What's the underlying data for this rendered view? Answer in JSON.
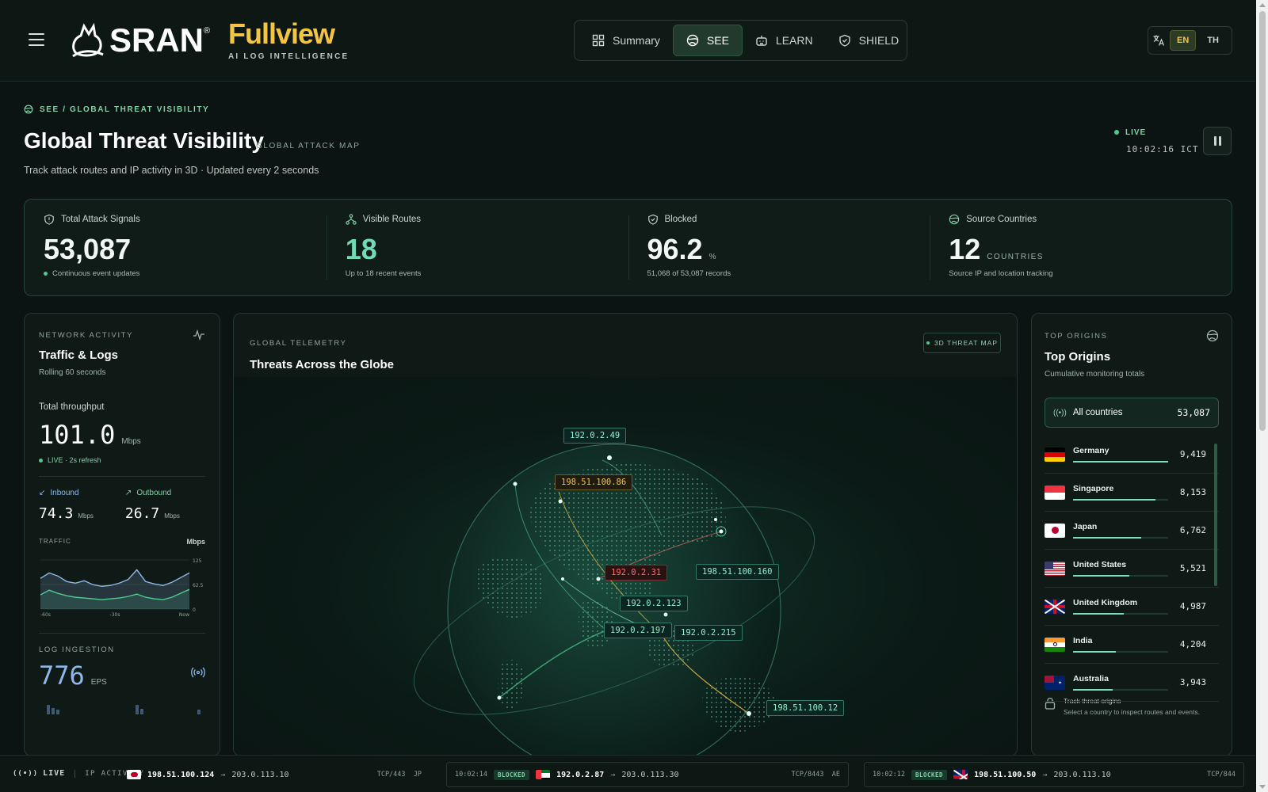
{
  "header": {
    "logo_text": "SRAN",
    "logo_reg": "®",
    "brand_title": "Fullview",
    "brand_sub": "AI LOG INTELLIGENCE",
    "nav": [
      {
        "label": "Summary",
        "icon": "grid-icon"
      },
      {
        "label": "SEE",
        "icon": "globe-icon",
        "active": true
      },
      {
        "label": "LEARN",
        "icon": "robot-icon"
      },
      {
        "label": "SHIELD",
        "icon": "shield-icon"
      }
    ],
    "lang": {
      "en": "EN",
      "th": "TH",
      "active": "EN"
    }
  },
  "page": {
    "breadcrumb": "SEE / GLOBAL THREAT VISIBILITY",
    "title": "Global Threat Visibility",
    "tag": "GLOBAL ATTACK MAP",
    "desc": "Track attack routes and IP activity in 3D · Updated every 2 seconds",
    "live_label": "LIVE",
    "clock": "10:02:16 ICT"
  },
  "stats": [
    {
      "label": "Total Attack Signals",
      "value": "53,087",
      "unit": "",
      "note": "Continuous event updates",
      "icon": "shield-icon"
    },
    {
      "label": "Visible Routes",
      "value": "18",
      "unit": "",
      "note": "Up to 18 recent events",
      "icon": "route-icon"
    },
    {
      "label": "Blocked",
      "value": "96.2",
      "unit": "%",
      "note": "51,068 of 53,087 records",
      "icon": "shield-check-icon"
    },
    {
      "label": "Source Countries",
      "value": "12",
      "unit": "COUNTRIES",
      "note": "Source IP and location tracking",
      "icon": "globe-icon"
    }
  ],
  "network": {
    "eyebrow": "NETWORK ACTIVITY",
    "title": "Traffic & Logs",
    "sub": "Rolling 60 seconds",
    "throughput_label": "Total throughput",
    "throughput_value": "101.0",
    "throughput_unit": "Mbps",
    "live_note": "LIVE · 2s refresh",
    "inbound_label": "Inbound",
    "inbound_value": "74.3",
    "outbound_label": "Outbound",
    "outbound_value": "26.7",
    "io_unit": "Mbps",
    "traffic_label": "TRAFFIC",
    "traffic_unit": "Mbps",
    "y_ticks": [
      "125",
      "62.5",
      "0"
    ],
    "x_ticks": [
      "-60s",
      "-30s",
      "Now"
    ],
    "inbound_series": [
      78,
      92,
      84,
      70,
      66,
      72,
      62,
      58,
      60,
      66,
      75,
      100,
      70,
      64,
      60,
      68,
      80,
      92
    ],
    "outbound_series": [
      36,
      48,
      40,
      34,
      30,
      28,
      26,
      24,
      26,
      28,
      32,
      38,
      30,
      26,
      24,
      30,
      40,
      50
    ],
    "log_label": "LOG INGESTION",
    "log_value": "776",
    "log_unit": "EPS",
    "colors": {
      "inbound": "#8fb8e8",
      "outbound": "#4ecb8f"
    }
  },
  "globe": {
    "eyebrow": "GLOBAL TELEMETRY",
    "title": "Threats Across the Globe",
    "button": "3D THREAT MAP",
    "ips": [
      {
        "ip": "192.0.2.49",
        "status": "normal"
      },
      {
        "ip": "198.51.100.86",
        "status": "warn"
      },
      {
        "ip": "192.0.2.31",
        "status": "bad"
      },
      {
        "ip": "198.51.100.160",
        "status": "normal"
      },
      {
        "ip": "192.0.2.123",
        "status": "normal"
      },
      {
        "ip": "192.0.2.197",
        "status": "normal"
      },
      {
        "ip": "192.0.2.215",
        "status": "normal"
      },
      {
        "ip": "198.51.100.12",
        "status": "normal"
      }
    ]
  },
  "origins": {
    "eyebrow": "TOP ORIGINS",
    "title": "Top Origins",
    "sub": "Cumulative monitoring totals",
    "all_label": "All countries",
    "all_value": "53,087",
    "items": [
      {
        "name": "Germany",
        "value": "9,419",
        "share": 1.0,
        "flag": "de"
      },
      {
        "name": "Singapore",
        "value": "8,153",
        "share": 0.87,
        "flag": "sg"
      },
      {
        "name": "Japan",
        "value": "6,762",
        "share": 0.72,
        "flag": "jp"
      },
      {
        "name": "United States",
        "value": "5,521",
        "share": 0.59,
        "flag": "us"
      },
      {
        "name": "United Kingdom",
        "value": "4,987",
        "share": 0.53,
        "flag": "gb"
      },
      {
        "name": "India",
        "value": "4,204",
        "share": 0.45,
        "flag": "in"
      },
      {
        "name": "Australia",
        "value": "3,943",
        "share": 0.42,
        "flag": "au"
      }
    ],
    "track_title": "Track threat origins",
    "track_sub": "Select a country to inspect routes and events."
  },
  "ticker": {
    "live": "LIVE",
    "label": "IP ACTIVITY",
    "items": [
      {
        "time": "",
        "status": "",
        "flag": "jp",
        "src": "198.51.100.124",
        "dst": "203.0.113.10",
        "proto": "TCP/443",
        "cc": "JP"
      },
      {
        "time": "10:02:14",
        "status": "BLOCKED",
        "flag": "ae",
        "src": "192.0.2.87",
        "dst": "203.0.113.30",
        "proto": "TCP/8443",
        "cc": "AE"
      },
      {
        "time": "10:02:12",
        "status": "BLOCKED",
        "flag": "gb",
        "src": "198.51.100.50",
        "dst": "203.0.113.10",
        "proto": "TCP/844",
        "cc": ""
      }
    ]
  }
}
